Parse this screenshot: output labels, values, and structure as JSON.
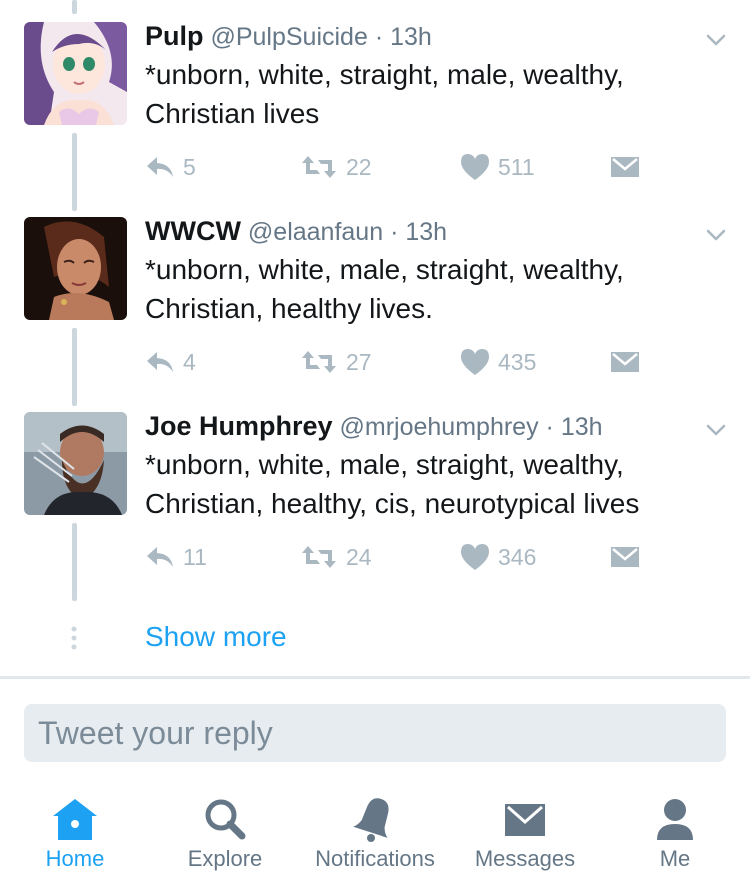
{
  "colors": {
    "accent": "#1da1f2",
    "muted": "#657786",
    "action_gray": "#aab8c2",
    "thread_line": "#ccd6dd",
    "reply_bg": "#e6ecf0"
  },
  "tweets": [
    {
      "name": "Pulp",
      "handle": "@PulpSuicide",
      "separator": "·",
      "time": "13h",
      "text": "*unborn, white, straight, male, wealthy, Christian lives",
      "replies": "5",
      "retweets": "22",
      "likes": "511"
    },
    {
      "name": "WWCW",
      "handle": "@elaanfaun",
      "separator": "·",
      "time": "13h",
      "text": "*unborn, white, male, straight, wealthy, Christian, healthy lives.",
      "replies": "4",
      "retweets": "27",
      "likes": "435"
    },
    {
      "name": "Joe Humphrey",
      "handle": "@mrjoehumphrey",
      "separator": "·",
      "time": "13h",
      "text": "*unborn, white, male, straight, wealthy, Christian, healthy, cis, neurotypical lives",
      "replies": "11",
      "retweets": "24",
      "likes": "346"
    }
  ],
  "show_more": "Show more",
  "reply": {
    "placeholder": "Tweet your reply"
  },
  "tabs": [
    {
      "label": "Home",
      "icon": "home-icon",
      "active": true
    },
    {
      "label": "Explore",
      "icon": "search-icon",
      "active": false
    },
    {
      "label": "Notifications",
      "icon": "bell-icon",
      "active": false
    },
    {
      "label": "Messages",
      "icon": "envelope-icon",
      "active": false
    },
    {
      "label": "Me",
      "icon": "person-icon",
      "active": false
    }
  ]
}
